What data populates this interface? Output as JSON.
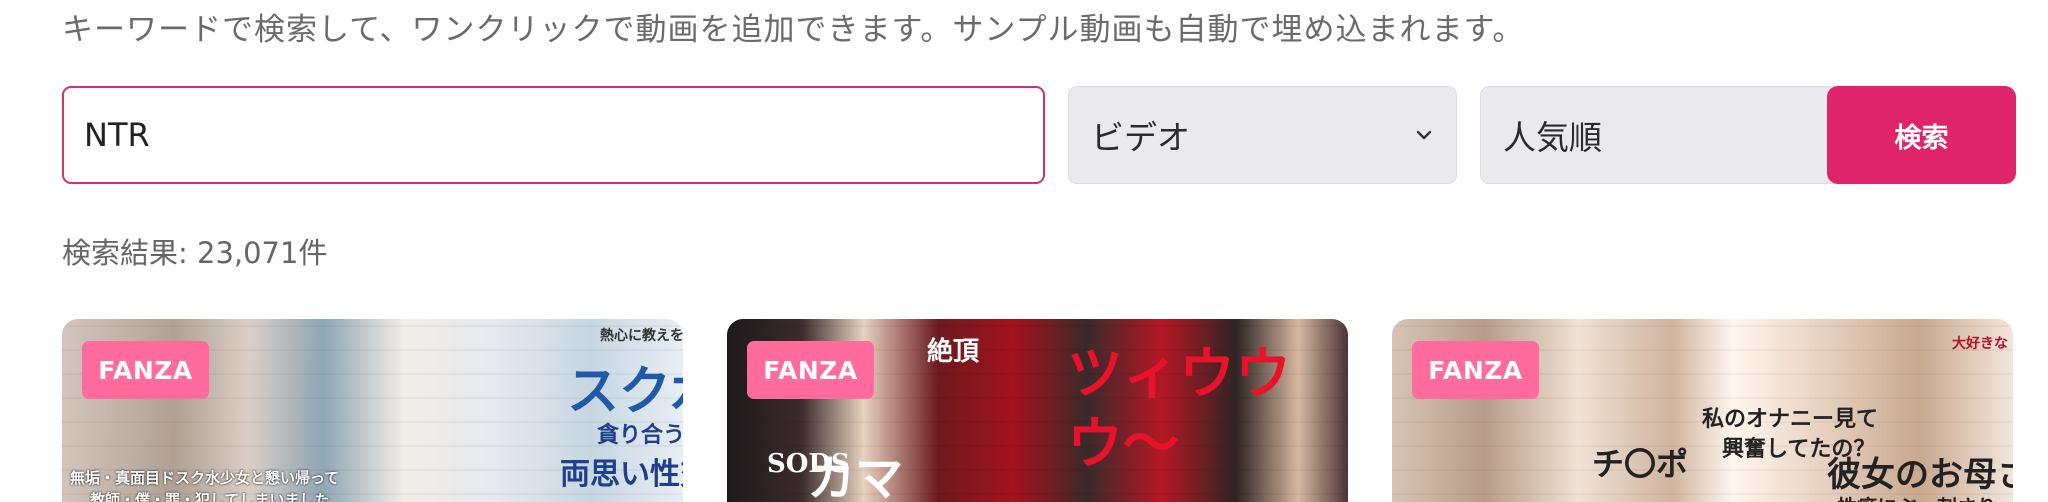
{
  "description": "キーワードで検索して、ワンクリックで動画を追加できます。サンプル動画も自動で埋め込まれます。",
  "search": {
    "value": "NTR",
    "button_label": "検索"
  },
  "filters": {
    "type_selected": "ビデオ",
    "sort_selected": "人気順"
  },
  "result_count": "検索結果: 23,071件",
  "cards": [
    {
      "badge": "FANZA",
      "texts": [
        "熱心に教えを求める",
        "スク水",
        "貪り合う",
        "両思い性交",
        "無垢・真面目ドスク水少女と懇い帰って",
        "教師・僕・罪・犯してしまいました"
      ]
    },
    {
      "badge": "FANZA",
      "texts": [
        "絶頂",
        "ツィウウ",
        "ウ～",
        "SODS",
        "カマ"
      ]
    },
    {
      "badge": "FANZA",
      "texts": [
        "私のオナニー見て",
        "興奮してたの？",
        "彼女のお母さ",
        "性癖にぶっ刺さり",
        "チ〇ポ",
        "大好きな"
      ]
    }
  ]
}
